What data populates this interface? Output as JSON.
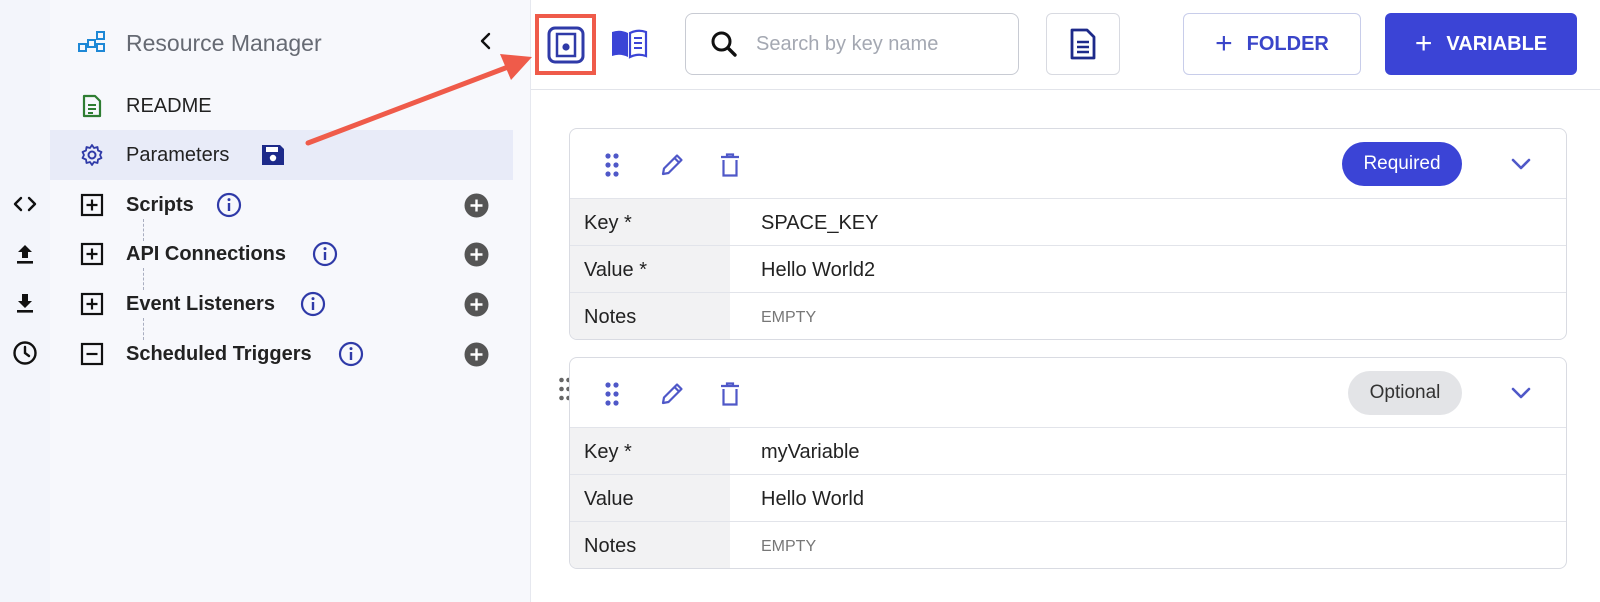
{
  "sidebar": {
    "title": "Resource Manager",
    "items": [
      {
        "label": "README"
      },
      {
        "label": "Parameters"
      },
      {
        "label": "Scripts"
      },
      {
        "label": "API Connections"
      },
      {
        "label": "Event Listeners"
      },
      {
        "label": "Scheduled Triggers"
      }
    ]
  },
  "toolbar": {
    "search_placeholder": "Search by key name",
    "folder_label": "FOLDER",
    "variable_label": "VARIABLE",
    "plus": "+"
  },
  "cards": [
    {
      "badge": "Required",
      "rows": [
        {
          "key": "Key *",
          "value": "SPACE_KEY"
        },
        {
          "key": "Value *",
          "value": "Hello World2"
        },
        {
          "key": "Notes",
          "value": "EMPTY"
        }
      ]
    },
    {
      "badge": "Optional",
      "rows": [
        {
          "key": "Key *",
          "value": "myVariable"
        },
        {
          "key": "Value",
          "value": "Hello World"
        },
        {
          "key": "Notes",
          "value": "EMPTY"
        }
      ]
    }
  ],
  "colors": {
    "accent": "#3b44d6",
    "highlight": "#ef5b4a",
    "readme_icon": "#2e7d32",
    "icon_blue": "#2f3aa8"
  },
  "icons": {
    "rail": [
      "code-icon",
      "upload-icon",
      "download-icon",
      "clock-icon"
    ],
    "card_actions": [
      "drag-icon",
      "edit-icon",
      "delete-icon",
      "chevron-down-icon"
    ]
  }
}
